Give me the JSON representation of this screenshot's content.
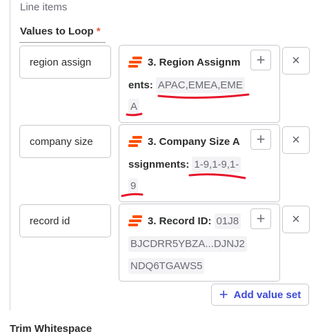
{
  "section": {
    "title": "Line items"
  },
  "field": {
    "label": "Values to Loop",
    "required_mark": "*"
  },
  "rows": [
    {
      "key": "region assign",
      "pill_label": "3. Region Assignm",
      "pill_label_cont": "ents:",
      "value_part1": "APAC,EMEA,EME",
      "value_part2": "A"
    },
    {
      "key": "company size",
      "pill_label": "3. Company Size A",
      "pill_label_cont": "ssignments:",
      "value_part1": "1-9,1-9,1-",
      "value_part2": "9"
    },
    {
      "key": "record id",
      "pill_label": "3. Record ID:",
      "value_part1": "01J8",
      "value_part2": "BJCDRR5YBZA...DJNJ2",
      "value_part3": "NDQ6TGAWS5"
    }
  ],
  "icons": {
    "plus": "+",
    "remove": "×",
    "app": "zapier-logo-icon"
  },
  "add_value_set": {
    "icon": "+",
    "label": "Add value set"
  },
  "next_field": {
    "label": "Trim Whitespace"
  },
  "colors": {
    "accent": "#3d4ad8",
    "app_orange": "#ff4f00",
    "required": "#e2583e",
    "annotation": "#e8142a"
  }
}
